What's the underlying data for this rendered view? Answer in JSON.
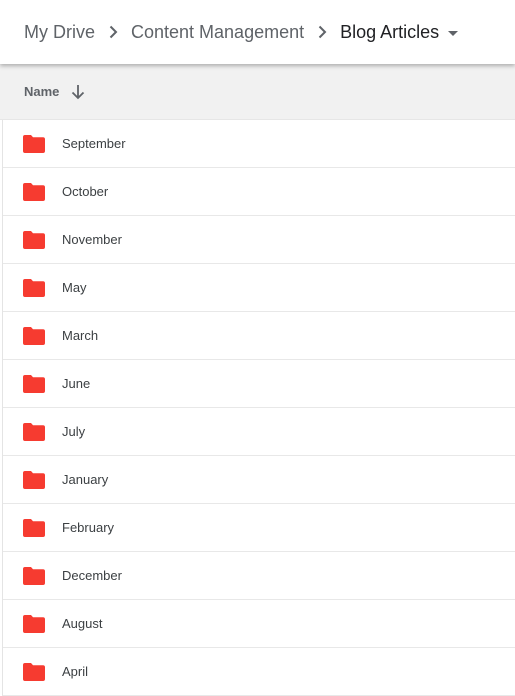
{
  "breadcrumb": {
    "items": [
      {
        "label": "My Drive"
      },
      {
        "label": "Content Management"
      },
      {
        "label": "Blog Articles"
      }
    ]
  },
  "list_header": {
    "name_label": "Name",
    "sort": "descending"
  },
  "folders": [
    {
      "name": "September"
    },
    {
      "name": "October"
    },
    {
      "name": "November"
    },
    {
      "name": "May"
    },
    {
      "name": "March"
    },
    {
      "name": "June"
    },
    {
      "name": "July"
    },
    {
      "name": "January"
    },
    {
      "name": "February"
    },
    {
      "name": "December"
    },
    {
      "name": "August"
    },
    {
      "name": "April"
    }
  ],
  "colors": {
    "folder": "#f63b30",
    "header_bg": "#f1f1f1",
    "text_secondary": "#5f6368",
    "text_primary": "#202124"
  },
  "icons": {
    "separator": "chevron-right-icon",
    "dropdown": "caret-down-icon",
    "sort": "arrow-down-icon",
    "folder": "folder-icon"
  }
}
